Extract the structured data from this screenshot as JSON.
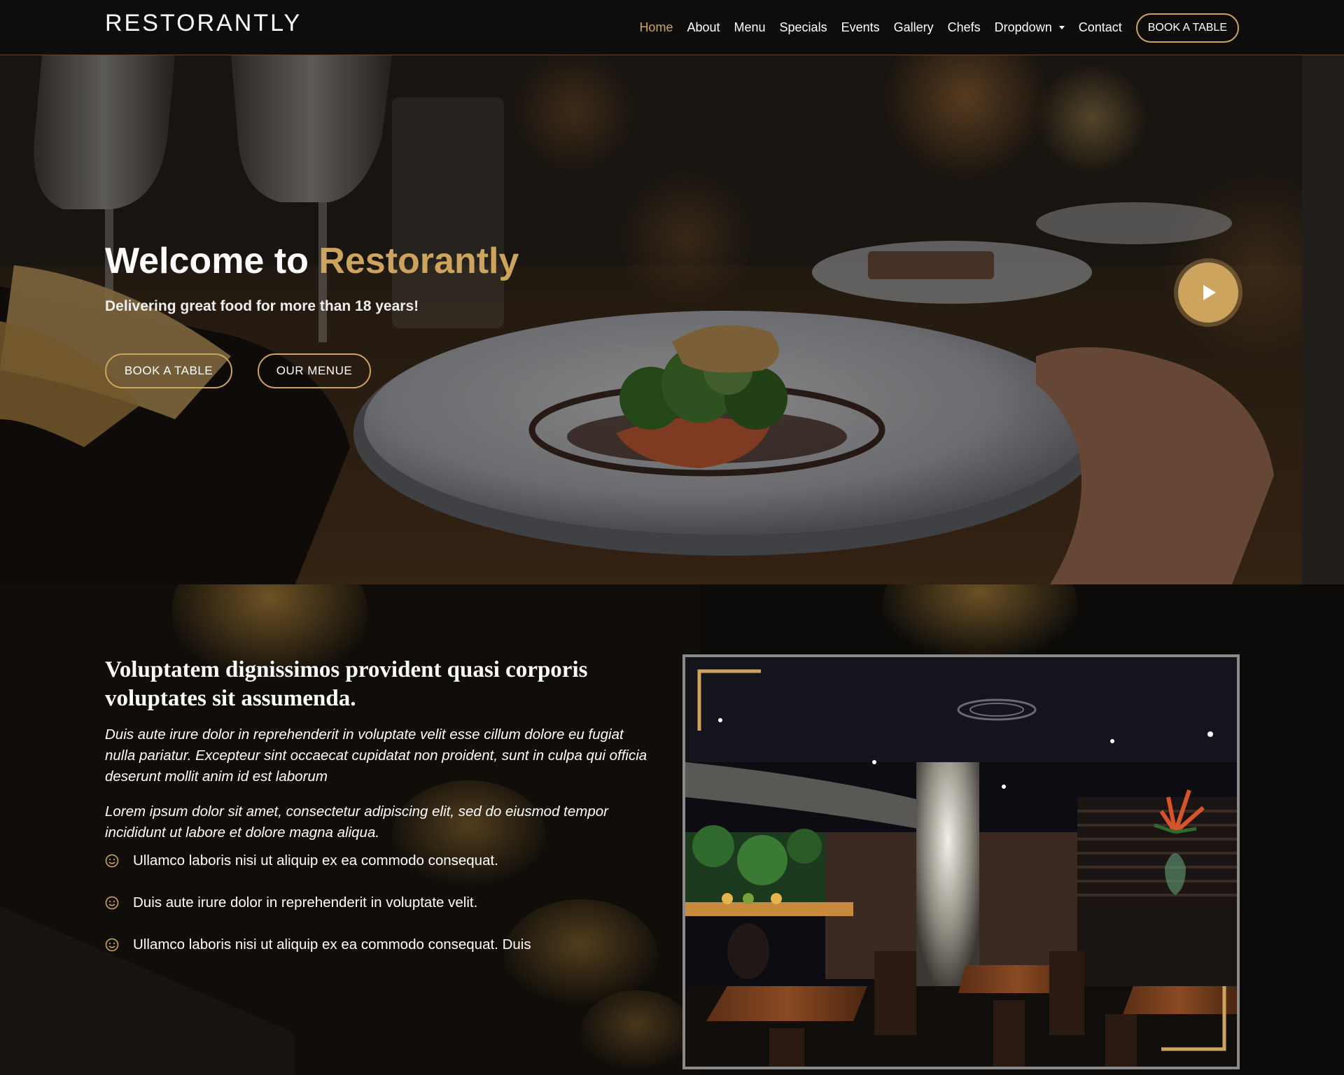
{
  "header": {
    "logo": "RESTORANTLY",
    "nav": [
      {
        "label": "Home",
        "active": true
      },
      {
        "label": "About"
      },
      {
        "label": "Menu"
      },
      {
        "label": "Specials"
      },
      {
        "label": "Events"
      },
      {
        "label": "Gallery"
      },
      {
        "label": "Chefs"
      },
      {
        "label": "Dropdown"
      },
      {
        "label": "Contact"
      }
    ],
    "book_label": "BOOK A TABLE"
  },
  "hero": {
    "title_prefix": "Welcome to ",
    "title_accent": "Restorantly",
    "subtitle": "Delivering great food for more than 18 years!",
    "book_button": "BOOK A TABLE",
    "menu_button": "OUR MENUE"
  },
  "about": {
    "title": "Voluptatem dignissimos provident quasi corporis voluptates sit assumenda.",
    "paragraph_1": "Duis aute irure dolor in reprehenderit in voluptate velit esse cillum dolore eu fugiat nulla pariatur. Excepteur sint occaecat cupidatat non proident, sunt in culpa qui officia deserunt mollit anim id est laborum",
    "paragraph_2": "Lorem ipsum dolor sit amet, consectetur adipiscing elit, sed do eiusmod tempor incididunt ut labore et dolore magna aliqua.",
    "list": [
      "Ullamco laboris nisi ut aliquip ex ea commodo consequat.",
      "Duis aute irure dolor in reprehenderit in voluptate velit.",
      "Ullamco laboris nisi ut aliquip ex ea commodo consequat. Duis"
    ]
  },
  "colors": {
    "accent": "#cda45e",
    "header_bg": "#0e0d0b",
    "body_bg": "#0c0b09"
  },
  "icons": {
    "play": "play-icon",
    "list_bullet": "smile-icon",
    "dropdown": "chevron-down-icon"
  }
}
